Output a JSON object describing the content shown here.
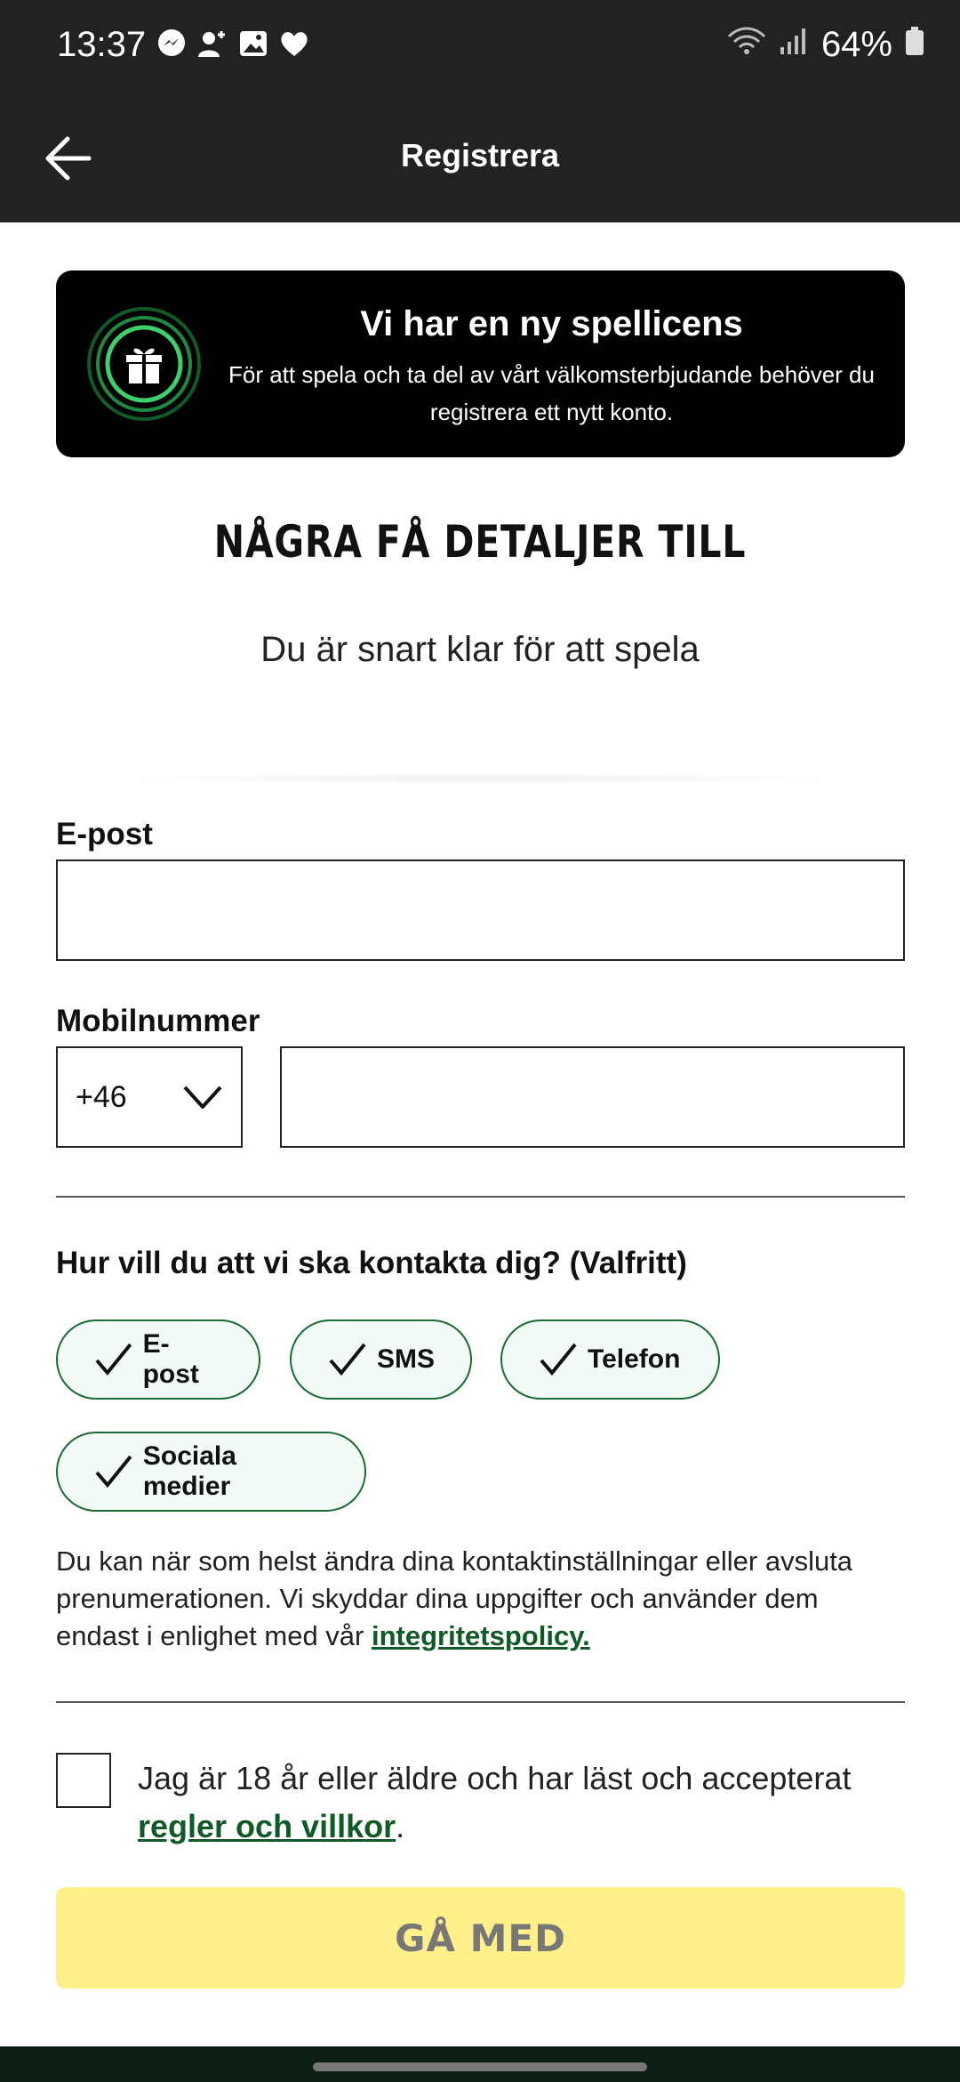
{
  "status_bar": {
    "time": "13:37",
    "battery": "64%",
    "icons": [
      "messenger-icon",
      "add-contact-icon",
      "gallery-icon",
      "heart-icon",
      "wifi-icon",
      "signal-icon",
      "battery-icon"
    ]
  },
  "app_bar": {
    "title": "Registrera"
  },
  "promo": {
    "title": "Vi har en ny spellicens",
    "text": "För att spela och ta del av vårt välkomsterbjudande behöver du registrera ett nytt konto."
  },
  "header": {
    "title": "NÅGRA FÅ DETALJER TILL",
    "subtitle": "Du är snart klar för att spela"
  },
  "form": {
    "email_label": "E-post",
    "email_value": "",
    "phone_label": "Mobilnummer",
    "country_code": "+46",
    "phone_value": ""
  },
  "contact": {
    "question": "Hur vill du att vi ska kontakta dig? (Valfritt)",
    "options": [
      {
        "label": "E-post",
        "checked": true
      },
      {
        "label": "SMS",
        "checked": true
      },
      {
        "label": "Telefon",
        "checked": true
      },
      {
        "label": "Sociala medier",
        "checked": true
      }
    ],
    "privacy_text": "Du kan när som helst ändra dina kontaktinställningar eller avsluta prenumerationen. Vi skyddar dina uppgifter och använder dem endast i enlighet med vår",
    "privacy_link": "integritetspolicy."
  },
  "terms": {
    "checked": false,
    "text": "Jag är 18 år eller äldre och har läst och accepterat",
    "link": "regler och villkor",
    "suffix": "."
  },
  "cta": {
    "label": "GÅ MED",
    "disabled": true
  },
  "colors": {
    "app_bar": "#222222",
    "accent_green": "#1a6b34",
    "chip_bg": "#f2fbf5",
    "cta_disabled": "#fff08a"
  }
}
